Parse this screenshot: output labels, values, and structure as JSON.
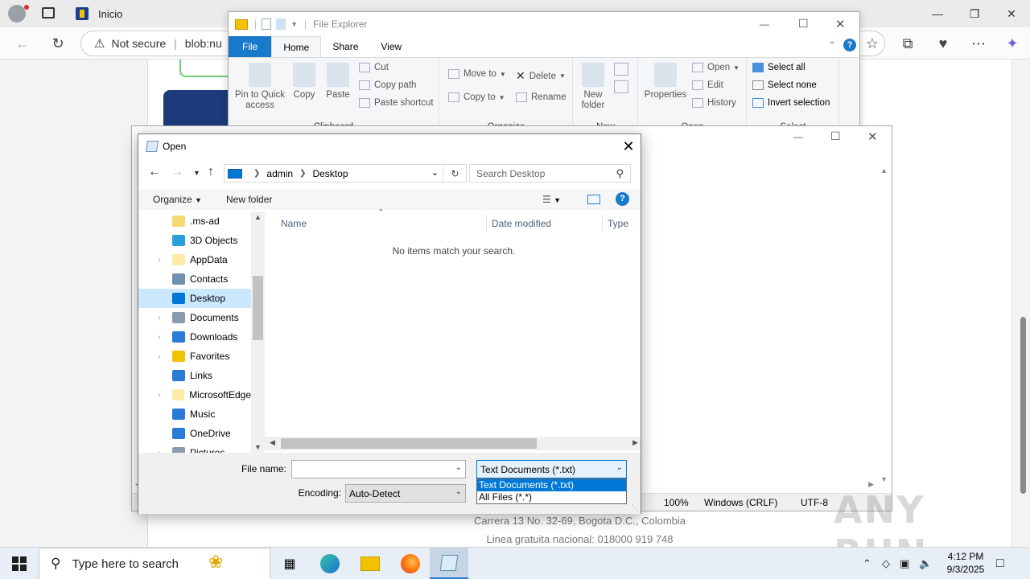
{
  "browser": {
    "tabs": [
      {
        "label": "Inicio"
      }
    ],
    "address": {
      "security_label": "Not secure",
      "url": "blob:nu"
    },
    "footer": {
      "address_line": "Carrera 13 No. 32-69, Bogota D.C., Colombia",
      "phone_line": "Linea gratuita nacional: 018000 919 748"
    }
  },
  "file_explorer": {
    "title": "File Explorer",
    "tabs": [
      "File",
      "Home",
      "Share",
      "View"
    ],
    "clipboard": {
      "pin_label": "Pin to Quick access",
      "copy_label": "Copy",
      "paste_label": "Paste",
      "cut_label": "Cut",
      "copy_path_label": "Copy path",
      "paste_shortcut_label": "Paste shortcut",
      "group_label": "Clipboard"
    },
    "organize": {
      "move_to_label": "Move to",
      "copy_to_label": "Copy to",
      "delete_label": "Delete",
      "rename_label": "Rename",
      "group_label": "Organize"
    },
    "new": {
      "new_folder_label": "New folder",
      "group_label": "New"
    },
    "open": {
      "properties_label": "Properties",
      "open_label": "Open",
      "edit_label": "Edit",
      "history_label": "History",
      "group_label": "Open"
    },
    "select": {
      "select_all_label": "Select all",
      "select_none_label": "Select none",
      "invert_label": "Invert selection",
      "group_label": "Select"
    }
  },
  "notepad": {
    "status": {
      "zoom": "100%",
      "line_endings": "Windows (CRLF)",
      "encoding": "UTF-8"
    }
  },
  "open_dialog": {
    "title": "Open",
    "breadcrumb": {
      "part1": "admin",
      "part2": "Desktop"
    },
    "search_placeholder": "Search Desktop",
    "organize_label": "Organize",
    "new_folder_label": "New folder",
    "tree": [
      {
        "label": ".ms-ad",
        "color": "#f5d774",
        "expandable": false
      },
      {
        "label": "3D Objects",
        "color": "#2a9fd8",
        "expandable": false
      },
      {
        "label": "AppData",
        "color": "#fde9a8",
        "expandable": true
      },
      {
        "label": "Contacts",
        "color": "#6f8fb3",
        "expandable": false
      },
      {
        "label": "Desktop",
        "color": "#0078d7",
        "expandable": false,
        "selected": true
      },
      {
        "label": "Documents",
        "color": "#8a9bb0",
        "expandable": true
      },
      {
        "label": "Downloads",
        "color": "#2a7bd8",
        "expandable": true
      },
      {
        "label": "Favorites",
        "color": "#f2c200",
        "expandable": true
      },
      {
        "label": "Links",
        "color": "#2a7bd8",
        "expandable": false
      },
      {
        "label": "MicrosoftEdge",
        "color": "#fde9a8",
        "expandable": true
      },
      {
        "label": "Music",
        "color": "#2a7bd8",
        "expandable": false
      },
      {
        "label": "OneDrive",
        "color": "#2a7bd8",
        "expandable": false
      },
      {
        "label": "Pictures",
        "color": "#8a9bb0",
        "expandable": true
      }
    ],
    "columns": {
      "name": "Name",
      "date_modified": "Date modified",
      "type": "Type"
    },
    "empty_message": "No items match your search.",
    "file_name_label": "File name:",
    "file_name_value": "",
    "file_type_value": "Text Documents (*.txt)",
    "file_type_options": [
      "Text Documents (*.txt)",
      "All Files  (*.*)"
    ],
    "encoding_label": "Encoding:",
    "encoding_value": "Auto-Detect"
  },
  "taskbar": {
    "search_placeholder": "Type here to search",
    "time": "4:12 PM",
    "date": "9/3/2025"
  },
  "watermark": "ANY RUN"
}
